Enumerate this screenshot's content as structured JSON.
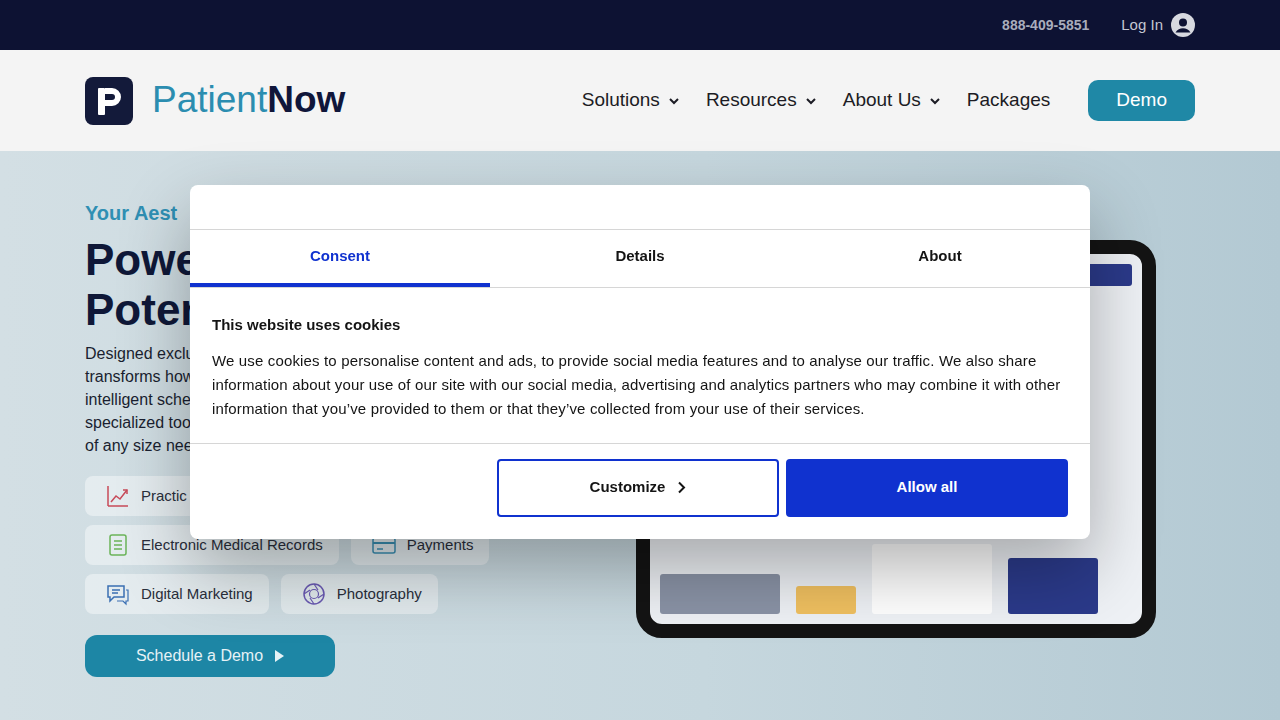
{
  "topbar": {
    "phone": "888-409-5851",
    "login": "Log In"
  },
  "logo": {
    "part1": "Patient",
    "part2": "Now"
  },
  "nav": [
    {
      "label": "Solutions",
      "dropdown": true
    },
    {
      "label": "Resources",
      "dropdown": true
    },
    {
      "label": "About Us",
      "dropdown": true
    },
    {
      "label": "Packages",
      "dropdown": false
    }
  ],
  "demo_button": "Demo",
  "hero": {
    "eyebrow": "Your Aest",
    "title_lines": [
      "Powe",
      "Poten"
    ],
    "body_lines": [
      "Designed exclus",
      "transforms how",
      "intelligent sche",
      "specialized tool",
      "of any size need"
    ],
    "feature_rows": [
      [
        {
          "label": "Practic"
        }
      ],
      [
        {
          "label": "Electronic Medical Records"
        },
        {
          "label": "Payments"
        }
      ],
      [
        {
          "label": "Digital Marketing"
        },
        {
          "label": "Photography"
        }
      ]
    ],
    "cta": "Schedule a Demo"
  },
  "cookie_dialog": {
    "tabs": [
      {
        "label": "Consent",
        "selected": true
      },
      {
        "label": "Details",
        "selected": false
      },
      {
        "label": "About",
        "selected": false
      }
    ],
    "title": "This website uses cookies",
    "text": "We use cookies to personalise content and ads, to provide social media features and to analyse our traffic. We also share information about your use of our site with our social media, advertising and analytics partners who may combine it with other information that you’ve provided to them or that they’ve collected from your use of their services.",
    "buttons": [
      {
        "label": "Customize",
        "kind": "outline"
      },
      {
        "label": "Allow all",
        "kind": "primary"
      }
    ]
  }
}
